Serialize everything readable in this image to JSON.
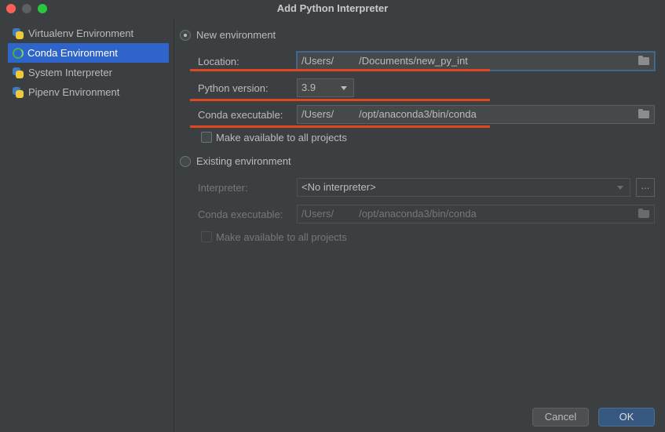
{
  "window": {
    "title": "Add Python Interpreter"
  },
  "sidebar": {
    "items": [
      {
        "label": "Virtualenv Environment",
        "icon": "python-icon",
        "selected": false
      },
      {
        "label": "Conda Environment",
        "icon": "conda-icon",
        "selected": true
      },
      {
        "label": "System Interpreter",
        "icon": "python-icon",
        "selected": false
      },
      {
        "label": "Pipenv Environment",
        "icon": "pipenv-icon",
        "selected": false
      }
    ]
  },
  "new_env": {
    "radio_label": "New environment",
    "selected": true,
    "location_label": "Location:",
    "location_prefix": "/Users/",
    "location_suffix": "/Documents/new_py_int",
    "python_version_label": "Python version:",
    "python_version_value": "3.9",
    "conda_exec_label": "Conda executable:",
    "conda_exec_prefix": "/Users/",
    "conda_exec_suffix": "/opt/anaconda3/bin/conda",
    "make_available_label": "Make available to all projects",
    "make_available_checked": false
  },
  "existing_env": {
    "radio_label": "Existing environment",
    "selected": false,
    "interpreter_label": "Interpreter:",
    "interpreter_value": "<No interpreter>",
    "browse_label": "...",
    "conda_exec_label": "Conda executable:",
    "conda_exec_prefix": "/Users/",
    "conda_exec_suffix": "/opt/anaconda3/bin/conda",
    "make_available_label": "Make available to all projects",
    "make_available_checked": false
  },
  "buttons": {
    "cancel": "Cancel",
    "ok": "OK"
  },
  "colors": {
    "background": "#3c3f41",
    "selection": "#2f65ca",
    "annotation": "#e0491f",
    "primary_button": "#365880"
  }
}
